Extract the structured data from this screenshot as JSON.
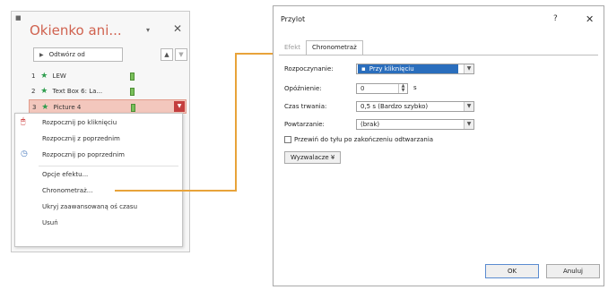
{
  "pane": {
    "pin_icon": "■",
    "title": "Okienko ani...",
    "dropdown_icon": "▾",
    "close_icon": "✕",
    "play_label": "Odtwórz od",
    "play_icon": "▶",
    "up_icon": "▲",
    "down_icon": "▼",
    "items": [
      {
        "num": "1",
        "label": "LEW"
      },
      {
        "num": "2",
        "label": "Text Box 6: La..."
      },
      {
        "num": "3",
        "label": "Picture 4"
      }
    ],
    "item_dropdown_icon": "▼"
  },
  "context_menu": {
    "items": [
      "Rozpocznij po kliknięciu",
      "Rozpocznij z poprzednim",
      "Rozpocznij po poprzednim",
      "Opcje efektu...",
      "Chronometraż...",
      "Ukryj zaawansowaną oś czasu",
      "Usuń"
    ],
    "mouse_icon": "🖱",
    "clock_icon": "◷"
  },
  "dialog": {
    "title": "Przylot",
    "help_icon": "?",
    "close_icon": "✕",
    "tabs": [
      "Efekt",
      "Chronometraż"
    ],
    "labels": {
      "start": "Rozpoczynanie:",
      "delay": "Opóźnienie:",
      "duration": "Czas trwania:",
      "repeat": "Powtarzanie:"
    },
    "start_value": "Przy kliknięciu",
    "delay_value": "0",
    "delay_unit": "s",
    "duration_value": "0,5 s (Bardzo szybko)",
    "repeat_value": "(brak)",
    "rewind_label": "Przewiń do tyłu po zakończeniu odtwarzania",
    "triggers_label": "Wyzwalacze ¥",
    "ok_label": "OK",
    "cancel_label": "Anuluj"
  },
  "colors": {
    "pane_title": "#d0624f",
    "star": "#2e9d4d",
    "selected_item": "#f3c7bd",
    "connector": "#e8a33a",
    "start_highlight": "#2a6ebd"
  }
}
